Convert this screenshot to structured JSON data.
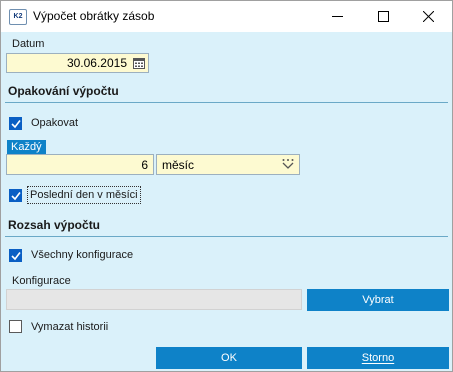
{
  "window": {
    "title": "Výpočet obrátky zásob",
    "app_icon_text": "K2"
  },
  "datum": {
    "label": "Datum",
    "value": "30.06.2015"
  },
  "opakovani": {
    "heading": "Opakování výpočtu",
    "opakovat_label": "Opakovat",
    "opakovat_checked": true,
    "kazdy_label": "Každý",
    "count_value": "6",
    "unit_value": "měsíc",
    "posledni_den_label": "Poslední den v měsíci",
    "posledni_den_checked": true
  },
  "rozsah": {
    "heading": "Rozsah výpočtu",
    "vsechny_label": "Všechny konfigurace",
    "vsechny_checked": true,
    "konfigurace_label": "Konfigurace",
    "konfigurace_value": "",
    "vybrat_button": "Vybrat"
  },
  "vymazat": {
    "label": "Vymazat historii",
    "checked": false
  },
  "buttons": {
    "ok": "OK",
    "storno": "Storno"
  },
  "colors": {
    "background": "#daf1fa",
    "accent": "#0e82c8",
    "input_yellow": "#fdfad1",
    "checkbox_blue": "#0a5fc4"
  }
}
